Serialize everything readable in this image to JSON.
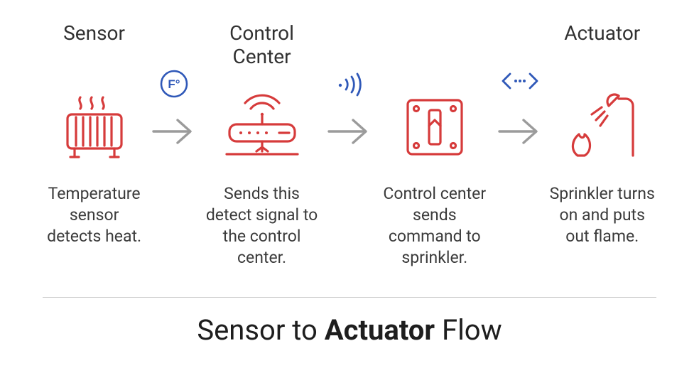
{
  "headers": {
    "sensor": "Sensor",
    "control_center": "Control Center",
    "actuator": "Actuator"
  },
  "captions": {
    "sensor": "Temperature sensor detects heat.",
    "send": "Sends this detect signal to the control center.",
    "command": "Control center sends command to sprinkler.",
    "sprinkler": "Sprinkler turns on and puts out flame."
  },
  "title": {
    "pre": "Sensor to ",
    "bold": "Actuator",
    "post": " Flow"
  },
  "colors": {
    "red": "#d63b3b",
    "blue": "#2f58b8",
    "grey": "#9b9b9b"
  },
  "icons": {
    "badge1": "temperature-fahrenheit-icon",
    "badge2": "signal-icon",
    "badge3": "code-ellipsis-icon"
  }
}
